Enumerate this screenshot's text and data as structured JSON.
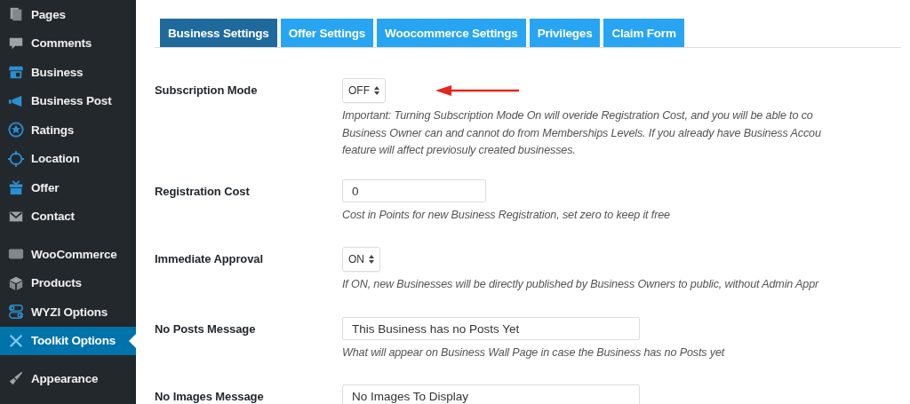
{
  "sidebar": {
    "items": [
      {
        "label": "Pages",
        "selected": false
      },
      {
        "label": "Comments",
        "selected": false
      },
      {
        "label": "Business",
        "selected": false
      },
      {
        "label": "Business Post",
        "selected": false
      },
      {
        "label": "Ratings",
        "selected": false
      },
      {
        "label": "Location",
        "selected": false
      },
      {
        "label": "Offer",
        "selected": false
      },
      {
        "label": "Contact",
        "selected": false
      },
      {
        "label": "WooCommerce",
        "selected": false
      },
      {
        "label": "Products",
        "selected": false
      },
      {
        "label": "WYZI Options",
        "selected": false
      },
      {
        "label": "Toolkit Options",
        "selected": true
      },
      {
        "label": "Appearance",
        "selected": false
      }
    ]
  },
  "tabs": [
    {
      "label": "Business Settings",
      "selected": true
    },
    {
      "label": "Offer Settings",
      "selected": false
    },
    {
      "label": "Woocommerce Settings",
      "selected": false
    },
    {
      "label": "Privileges",
      "selected": false
    },
    {
      "label": "Claim Form",
      "selected": false
    }
  ],
  "settings": [
    {
      "kind": "select",
      "label": "Subscription Mode",
      "value": "OFF",
      "help": [
        "Important: Turning Subscription Mode On will overide Registration Cost, and you will be able to co",
        "Business Owner can and cannot do from Memberships Levels. If you already have Business Accou",
        "feature will affect previosuly created businesses."
      ]
    },
    {
      "kind": "text",
      "label": "Registration Cost",
      "value": "0",
      "help": [
        "Cost in Points for new Business Registration, set zero to keep it free"
      ]
    },
    {
      "kind": "select",
      "label": "Immediate Approval",
      "value": "ON",
      "help": [
        "If ON, new Businesses will be directly published by Business Owners to public, without Admin Appr"
      ]
    },
    {
      "kind": "text",
      "label": "No Posts Message",
      "value": "This Business has no Posts Yet",
      "help": [
        "What will appear on Business Wall Page in case the Business has no Posts yet"
      ]
    },
    {
      "kind": "text",
      "label": "No Images Message",
      "value": "No Images To Display"
    }
  ]
}
